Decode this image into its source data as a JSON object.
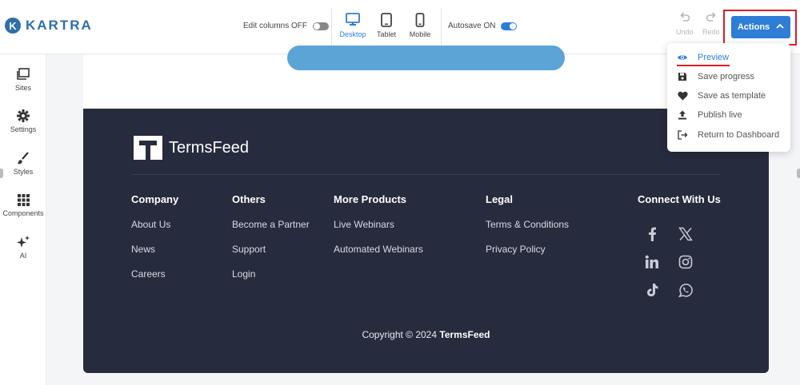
{
  "brand": {
    "logo_letter": "K",
    "name": "KARTRA",
    "color": "#2d6fa8"
  },
  "toolbar": {
    "edit_columns_label": "Edit columns OFF",
    "edit_columns_on": false,
    "devices": [
      {
        "label": "Desktop",
        "icon": "desktop-icon",
        "active": true
      },
      {
        "label": "Tablet",
        "icon": "tablet-icon",
        "active": false
      },
      {
        "label": "Mobile",
        "icon": "mobile-icon",
        "active": false
      }
    ],
    "autosave_label": "Autosave ON",
    "autosave_on": true,
    "undo_label": "Undo",
    "redo_label": "Redo",
    "actions_label": "Actions",
    "accent": "#2e7dd6"
  },
  "sidebar": {
    "items": [
      {
        "label": "Sites",
        "icon": "sites-icon"
      },
      {
        "label": "Settings",
        "icon": "gear-icon"
      },
      {
        "label": "Styles",
        "icon": "brush-icon"
      },
      {
        "label": "Components",
        "icon": "grid-icon"
      },
      {
        "label": "AI",
        "icon": "sparkle-icon"
      }
    ]
  },
  "footer": {
    "brand": "TermsFeed",
    "background": "#272b3e",
    "columns": [
      {
        "title": "Company",
        "links": [
          "About Us",
          "News",
          "Careers"
        ]
      },
      {
        "title": "Others",
        "links": [
          "Become a Partner",
          "Support",
          "Login"
        ]
      },
      {
        "title": "More Products",
        "links": [
          "Live Webinars",
          "Automated Webinars"
        ]
      },
      {
        "title": "Legal",
        "links": [
          "Terms & Conditions",
          "Privacy Policy"
        ]
      }
    ],
    "connect_title": "Connect With Us",
    "social": [
      "facebook-icon",
      "x-icon",
      "linkedin-icon",
      "instagram-icon",
      "tiktok-icon",
      "whatsapp-icon"
    ],
    "copyright_prefix": "Copyright © 2024",
    "copyright_brand": "TermsFeed"
  },
  "dropdown": {
    "items": [
      {
        "label": "Preview",
        "icon": "eye-icon",
        "active": true
      },
      {
        "label": "Save progress",
        "icon": "save-icon",
        "active": false
      },
      {
        "label": "Save as template",
        "icon": "heart-icon",
        "active": false
      },
      {
        "label": "Publish live",
        "icon": "upload-icon",
        "active": false
      },
      {
        "label": "Return to Dashboard",
        "icon": "exit-icon",
        "active": false
      }
    ]
  }
}
